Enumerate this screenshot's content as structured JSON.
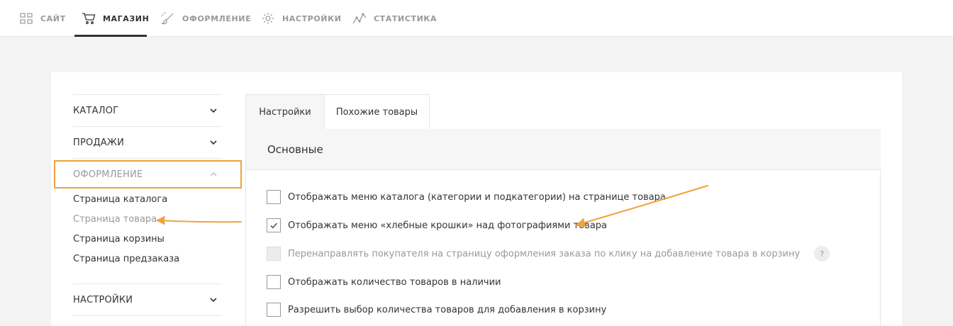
{
  "topnav": {
    "items": [
      {
        "label": "САЙТ",
        "icon": "grid-icon"
      },
      {
        "label": "МАГАЗИН",
        "icon": "cart-icon"
      },
      {
        "label": "ОФОРМЛЕНИЕ",
        "icon": "brush-icon"
      },
      {
        "label": "НАСТРОЙКИ",
        "icon": "gear-icon"
      },
      {
        "label": "СТАТИСТИКА",
        "icon": "chart-line-icon"
      }
    ],
    "active_index": 1
  },
  "sidebar": {
    "sections": [
      {
        "label": "КАТАЛОГ",
        "expanded": false
      },
      {
        "label": "ПРОДАЖИ",
        "expanded": false
      },
      {
        "label": "ОФОРМЛЕНИЕ",
        "expanded": true
      },
      {
        "label": "НАСТРОЙКИ",
        "expanded": false
      }
    ],
    "links": [
      {
        "label": "Страница каталога"
      },
      {
        "label": "Страница товара"
      },
      {
        "label": "Страница корзины"
      },
      {
        "label": "Страница предзаказа"
      }
    ],
    "current_link_index": 1
  },
  "tabs": [
    {
      "label": "Настройки",
      "active": true
    },
    {
      "label": "Похожие товары",
      "active": false
    }
  ],
  "content": {
    "section_title": "Основные",
    "options": [
      {
        "label": "Отображать меню каталога (категории и подкатегории) на странице товара",
        "checked": false,
        "disabled": false
      },
      {
        "label": "Отображать меню «хлебные крошки» над фотографиями товара",
        "checked": true,
        "disabled": false
      },
      {
        "label": "Перенаправлять покупателя на страницу оформления заказа по клику на добавление товара в корзину",
        "checked": false,
        "disabled": true,
        "help": "?"
      },
      {
        "label": "Отображать количество товаров в наличии",
        "checked": false,
        "disabled": false
      },
      {
        "label": "Разрешить выбор количества товаров для добавления в корзину",
        "checked": false,
        "disabled": false
      }
    ]
  },
  "colors": {
    "annotation": "#f0a23d",
    "text": "#333333",
    "muted": "#999999",
    "background": "#f3f3f3"
  }
}
